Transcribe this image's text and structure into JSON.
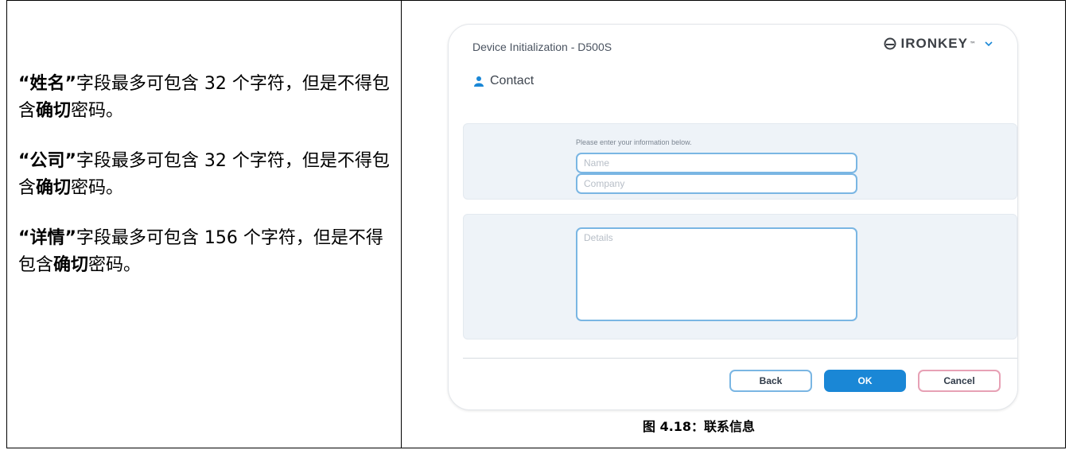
{
  "instructions": [
    {
      "term": "“姓名”",
      "text1": "字段最多可包含 32 个字符，但是不得包含",
      "emph": "确切",
      "text2": "密码。"
    },
    {
      "term": "“公司”",
      "text1": "字段最多可包含 32 个字符，但是不得包含",
      "emph": "确切",
      "text2": "密码。"
    },
    {
      "term": "“详情”",
      "text1": "字段最多可包含 156 个字符，但是不得包含",
      "emph": "确切",
      "text2": "密码。"
    }
  ],
  "dialog": {
    "title": "Device Initialization - D500S",
    "logo_text": "IRONKEY",
    "logo_tm": "™",
    "section_label": "Contact",
    "hint": "Please enter your information below.",
    "name_placeholder": "Name",
    "company_placeholder": "Company",
    "details_placeholder": "Details",
    "buttons": {
      "back": "Back",
      "ok": "OK",
      "cancel": "Cancel"
    },
    "colors": {
      "accent": "#1a87d6",
      "field_border": "#7ab6e3",
      "cancel_border": "#e7a1b5",
      "panel_bg": "#eef3f8"
    }
  },
  "caption": "图 4.18：联系信息"
}
